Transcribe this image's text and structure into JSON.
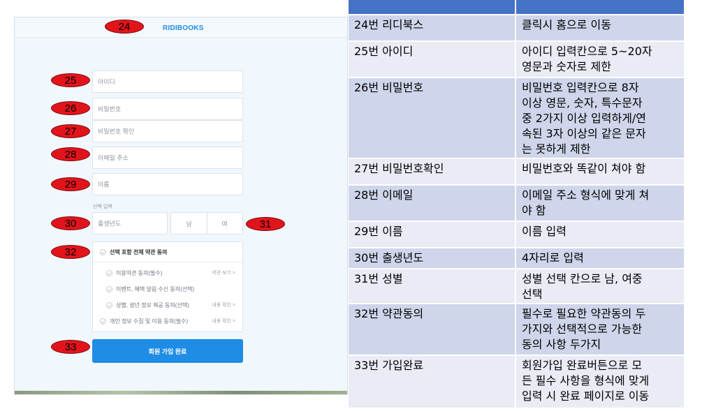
{
  "mockup": {
    "logo": "RIDIBOOKS",
    "fields": {
      "id_placeholder": "아이디",
      "password_placeholder": "비밀번호",
      "password_confirm_placeholder": "비밀번호 확인",
      "email_placeholder": "이메일 주소",
      "name_placeholder": "이름"
    },
    "optional_label": "선택 입력",
    "birth_year_placeholder": "출생년도",
    "gender": {
      "male": "남",
      "female": "여"
    },
    "terms": {
      "all": "선택 포함 전체 약관 동의",
      "items": [
        {
          "label": "이용약관 동의(필수)",
          "link": "약관 보기 >"
        },
        {
          "label": "이벤트, 혜택 알림 수신 동의(선택)",
          "link": ""
        },
        {
          "label": "성별, 생년 정보 제공 동의(선택)",
          "link": "내용 확인 >"
        },
        {
          "label": "개인 정보 수집 및 이용 동의(필수)",
          "link": "내용 확인 >"
        }
      ]
    },
    "submit_label": "회원 가입 완료",
    "markers": [
      "24",
      "25",
      "26",
      "27",
      "28",
      "29",
      "30",
      "31",
      "32",
      "33"
    ]
  },
  "table": {
    "header": [
      "",
      ""
    ],
    "rows": [
      {
        "item": "24번 리디북스",
        "description": "클릭시 홈으로 이동"
      },
      {
        "item": "25번 아이디",
        "description": "아이디 입력칸으로 5~20자\n영문과 숫자로 제한"
      },
      {
        "item": "26번 비밀번호",
        "description": "비밀번호 입력칸으로 8자\n이상 영문, 숫자, 특수문자\n중 2가지 이상 입력하게/연\n속된 3자 이상의 같은 문자\n는 못하게 제한"
      },
      {
        "item": "27번 비밀번호확인",
        "description": "비밀번호와 똑같이 쳐야 함"
      },
      {
        "item": "28번 이메일",
        "description": "이메일 주소 형식에 맞게 쳐\n야 함"
      },
      {
        "item": "29번 이름",
        "description": "이름 입력"
      },
      {
        "item": "30번 출생년도",
        "description": "4자리로 입력"
      },
      {
        "item": "31번 성별",
        "description": "성별 선택 칸으로 남, 여중\n선택"
      },
      {
        "item": "32번 약관동의",
        "description": "필수로 필요한 약관동의 두\n가지와 선택적으로 가능한\n동의 사항 두가지"
      },
      {
        "item": "33번 가입완료",
        "description": "회원가입 완료버튼으로 모\n든 필수 사항을 형식에 맞게\n입력 시 완료 페이지로 이동"
      }
    ]
  },
  "colors": {
    "header_blue": "#4472c4",
    "row_dark": "#cfd5ea",
    "row_light": "#e9ebf5",
    "marker_red": "#e2141b",
    "brand_blue": "#1f8ce6"
  }
}
